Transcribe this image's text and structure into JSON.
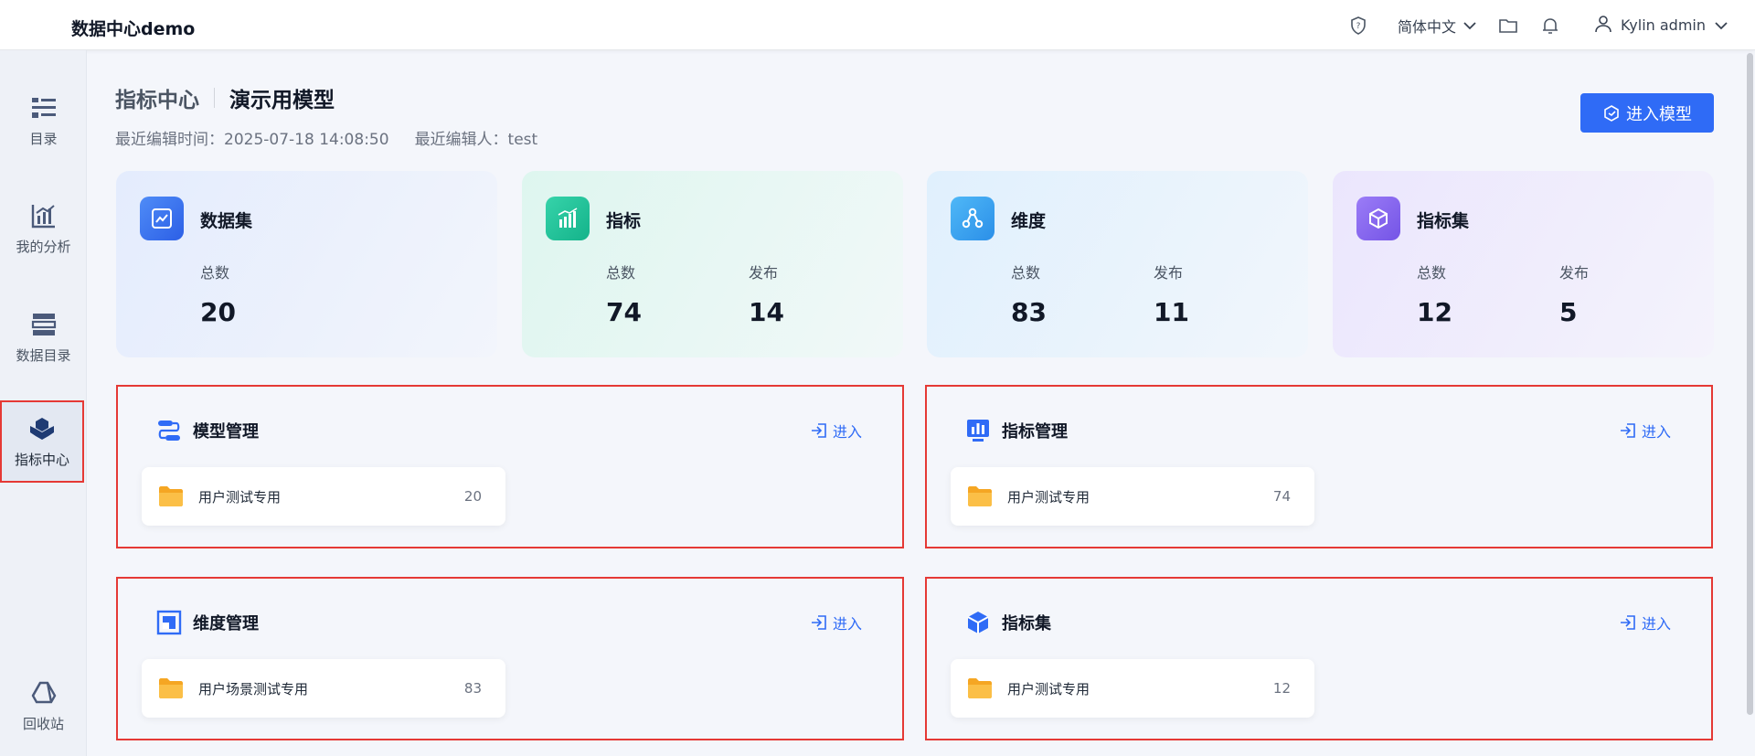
{
  "app": {
    "title": "数据中心demo"
  },
  "topbar": {
    "language": "简体中文",
    "user": "Kylin admin"
  },
  "sidebar": {
    "items": [
      {
        "label": "目录",
        "icon": "catalog-icon"
      },
      {
        "label": "我的分析",
        "icon": "analysis-icon"
      },
      {
        "label": "数据目录",
        "icon": "data-catalog-icon"
      },
      {
        "label": "指标中心",
        "icon": "metrics-center-icon",
        "active": true
      },
      {
        "label": "回收站",
        "icon": "recycle-bin-icon"
      }
    ]
  },
  "header": {
    "section": "指标中心",
    "model": "演示用模型",
    "last_edit_time": "最近编辑时间：2025-07-18 14:08:50",
    "last_editor": "最近编辑人：test",
    "enter_model_label": "进入模型"
  },
  "stats": [
    {
      "title": "数据集",
      "total_label": "总数",
      "total": "20"
    },
    {
      "title": "指标",
      "total_label": "总数",
      "total": "74",
      "published_label": "发布",
      "published": "14"
    },
    {
      "title": "维度",
      "total_label": "总数",
      "total": "83",
      "published_label": "发布",
      "published": "11"
    },
    {
      "title": "指标集",
      "total_label": "总数",
      "total": "12",
      "published_label": "发布",
      "published": "5"
    }
  ],
  "sections": [
    {
      "title": "模型管理",
      "enter_label": "进入",
      "folder": {
        "name": "用户测试专用",
        "count": "20"
      }
    },
    {
      "title": "指标管理",
      "enter_label": "进入",
      "folder": {
        "name": "用户测试专用",
        "count": "74"
      }
    },
    {
      "title": "维度管理",
      "enter_label": "进入",
      "folder": {
        "name": "用户场景测试专用",
        "count": "83"
      }
    },
    {
      "title": "指标集",
      "enter_label": "进入",
      "folder": {
        "name": "用户测试专用",
        "count": "12"
      }
    }
  ],
  "colors": {
    "accent": "#2f6bf6",
    "highlight_border": "#e53935",
    "folder": "#f5a623"
  }
}
